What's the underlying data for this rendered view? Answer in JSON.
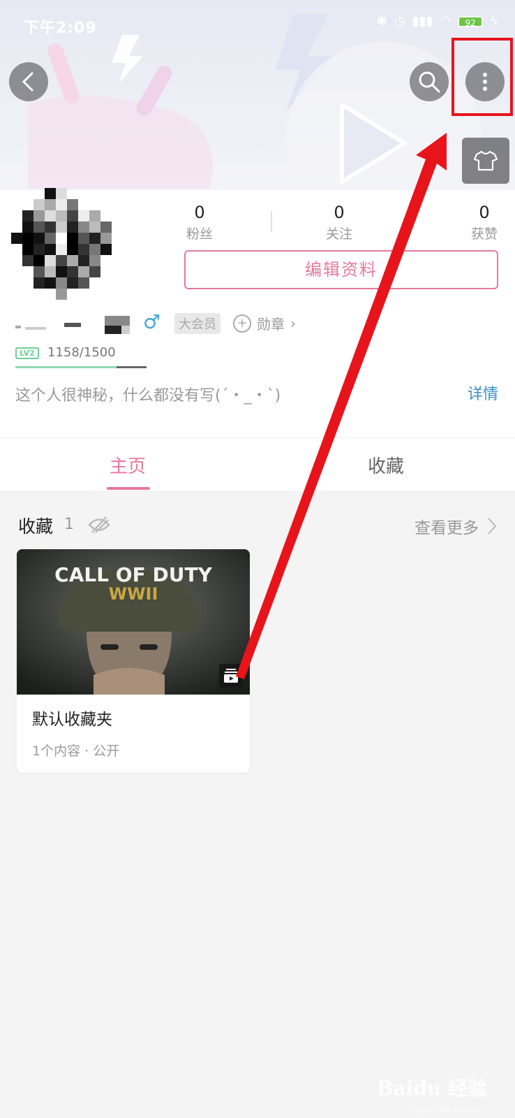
{
  "status_bar": {
    "time": "下午2:09",
    "battery": "92"
  },
  "header": {
    "back_icon": "chevron-left-icon",
    "search_icon": "search-icon",
    "more_icon": "more-vertical-icon",
    "skin_icon": "tshirt-icon"
  },
  "profile": {
    "stats": [
      {
        "value": "0",
        "label": "粉丝"
      },
      {
        "value": "0",
        "label": "关注"
      },
      {
        "value": "0",
        "label": "获赞"
      }
    ],
    "edit_button": "编辑资料",
    "gender_symbol": "♂",
    "vip_badge": "大会员",
    "medal_label": "勋章",
    "medal_chevron": "›",
    "level": "LV2",
    "exp_text": "1158/1500",
    "exp_progress": 0.772,
    "signature": "这个人很神秘，什么都没有写(´・_・`)",
    "detail_link": "详情"
  },
  "tabs": [
    {
      "label": "主页",
      "active": true
    },
    {
      "label": "收藏",
      "active": false
    }
  ],
  "favorites": {
    "title": "收藏",
    "count": "1",
    "more_link": "查看更多",
    "cards": [
      {
        "thumbnail_text_line1": "CALL OF DUTY",
        "thumbnail_text_line2": "WWII",
        "title": "默认收藏夹",
        "meta": "1个内容 · 公开"
      }
    ]
  },
  "watermark": {
    "brand": "Baidu 经验",
    "url": "jingyan.baidu.com"
  },
  "colors": {
    "accent_pink": "#e8789b",
    "link_blue": "#3a8fc7",
    "level_green": "#6fcf97",
    "annotation_red": "#e8141b"
  }
}
